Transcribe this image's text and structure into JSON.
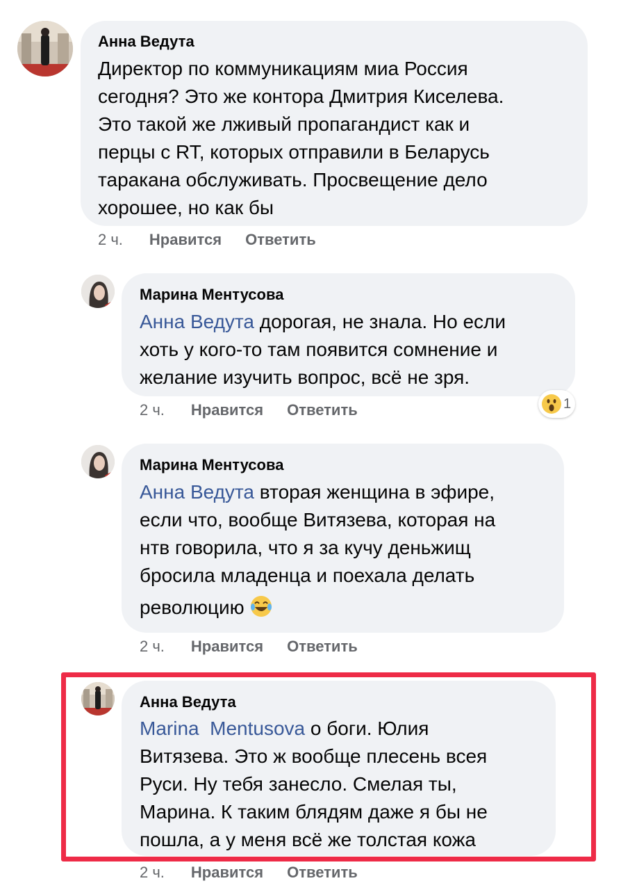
{
  "comments": [
    {
      "author": "Анна Ведута",
      "mention": "",
      "text_lines": [
        "Директор по коммуникациям миа Россия",
        "сегодня? Это же контора Дмитрия Киселева.",
        "Это такой же лживый пропагандист как и",
        "перцы с RT, которых отправили в Беларусь",
        "таракана обслуживать. Просвещение дело",
        "хорошее, но как бы"
      ],
      "time": "2 ч.",
      "like_label": "Нравится",
      "reply_label": "Ответить"
    },
    {
      "author": "Марина Ментусова",
      "mention": "Анна Ведута",
      "first_line_rest": " дорогая, не знала. Но если",
      "text_lines": [
        "хоть у кого-то там появится сомнение и",
        "желание изучить вопрос, всё не зря."
      ],
      "time": "2 ч.",
      "like_label": "Нравится",
      "reply_label": "Ответить",
      "reaction": {
        "icon": "wow-emoji-icon",
        "count": "1"
      }
    },
    {
      "author": "Марина Ментусова",
      "mention": "Анна Ведута",
      "first_line_rest": " вторая женщина в эфире,",
      "text_lines": [
        "если что, вообще Витязева, которая на",
        "нтв говорила, что я за кучу деньжищ",
        "бросила младенца и поехала делать",
        "революцию"
      ],
      "emoji_icon": "laughing-tears-emoji-icon",
      "time": "2 ч.",
      "like_label": "Нравится",
      "reply_label": "Ответить"
    },
    {
      "author": "Анна Ведута",
      "mention": "Marina  Mentusova",
      "first_line_rest": " о боги. Юлия",
      "text_lines": [
        "Витязева. Это ж вообще плесень всея",
        "Руси. Ну тебя занесло. Смелая ты,",
        "Марина. К таким блядям даже я бы не",
        "пошла, а у меня всё же толстая кожа"
      ],
      "time": "2 ч.",
      "like_label": "Нравится",
      "reply_label": "Ответить"
    }
  ],
  "colors": {
    "bubble": "#f0f2f5",
    "mention": "#385898",
    "meta": "#65676b",
    "highlight_border": "#ee2b47"
  }
}
